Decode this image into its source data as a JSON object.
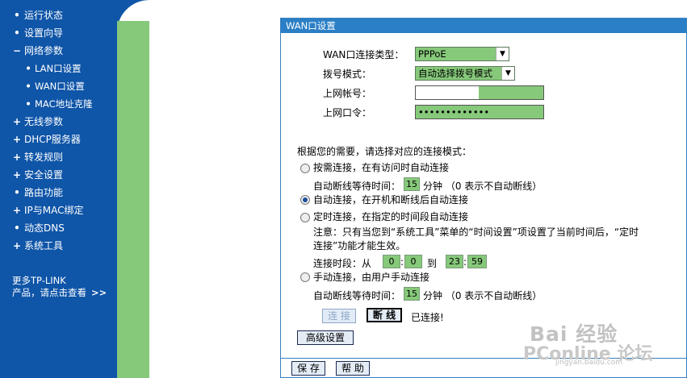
{
  "sidebar": {
    "items": [
      {
        "mark": "•",
        "label": "运行状态",
        "level": 1
      },
      {
        "mark": "•",
        "label": "设置向导",
        "level": 1
      },
      {
        "mark": "−",
        "label": "网络参数",
        "level": 1
      },
      {
        "mark": "•",
        "label": "LAN口设置",
        "level": 2
      },
      {
        "mark": "•",
        "label": "WAN口设置",
        "level": 2
      },
      {
        "mark": "•",
        "label": "MAC地址克隆",
        "level": 2
      },
      {
        "mark": "+",
        "label": "无线参数",
        "level": 1
      },
      {
        "mark": "+",
        "label": "DHCP服务器",
        "level": 1
      },
      {
        "mark": "+",
        "label": "转发规则",
        "level": 1
      },
      {
        "mark": "+",
        "label": "安全设置",
        "level": 1
      },
      {
        "mark": "•",
        "label": "路由功能",
        "level": 1
      },
      {
        "mark": "+",
        "label": "IP与MAC绑定",
        "level": 1
      },
      {
        "mark": "•",
        "label": "动态DNS",
        "level": 1
      },
      {
        "mark": "+",
        "label": "系统工具",
        "level": 1
      }
    ],
    "more_line1": "更多TP-LINK",
    "more_line2": "产品，请点击查看",
    "more_chevron": ">>"
  },
  "panel": {
    "title": "WAN口设置",
    "wan_type_label": "WAN口连接类型：",
    "wan_type_value": "PPPoE",
    "dial_mode_label": "拨号模式：",
    "dial_mode_value": "自动选择拨号模式",
    "account_label": "上网帐号：",
    "account_value": "",
    "password_label": "上网口令：",
    "password_value": "•••••••••••••",
    "mode_prompt": "根据您的需要，请选择对应的连接模式：",
    "option_on_demand": "按需连接，在有访问时自动连接",
    "idle_label_1": "自动断线等待时间：",
    "idle_value_1": "15",
    "idle_unit_1": "分钟 （0 表示不自动断线）",
    "option_auto": "自动连接，在开机和断线后自动连接",
    "option_timed": "定时连接，在指定的时间段自动连接",
    "note_line1": "注意：只有当您到“系统工具”菜单的“时间设置”项设置了当前时间后，“定时",
    "note_line2": "连接”功能才能生效。",
    "period_label": "连接时段：从",
    "period_from_h": "0",
    "period_from_m": "0",
    "period_to_label": "到",
    "period_to_h": "23",
    "period_to_m": "59",
    "colon": ":",
    "option_manual": "手动连接，由用户手动连接",
    "idle_label_2": "自动断线等待时间：",
    "idle_value_2": "15",
    "idle_unit_2": "分钟 （0 表示不自动断线）",
    "connect_button": "连 接",
    "disconnect_button": "断 线",
    "status_text": "已连接!",
    "advanced_button": "高级设置",
    "save_button": "保 存",
    "help_button": "帮 助",
    "selected_mode": "auto"
  },
  "watermark": {
    "main": "Bai 经验",
    "sub": "PConline 论坛",
    "url": "jingyan.baidu.com"
  },
  "colors": {
    "sidebar_bg": "#0f55a8",
    "green_strip": "#86c97a",
    "header_bg": "#2a7fc6",
    "field_green": "#86c97a"
  }
}
